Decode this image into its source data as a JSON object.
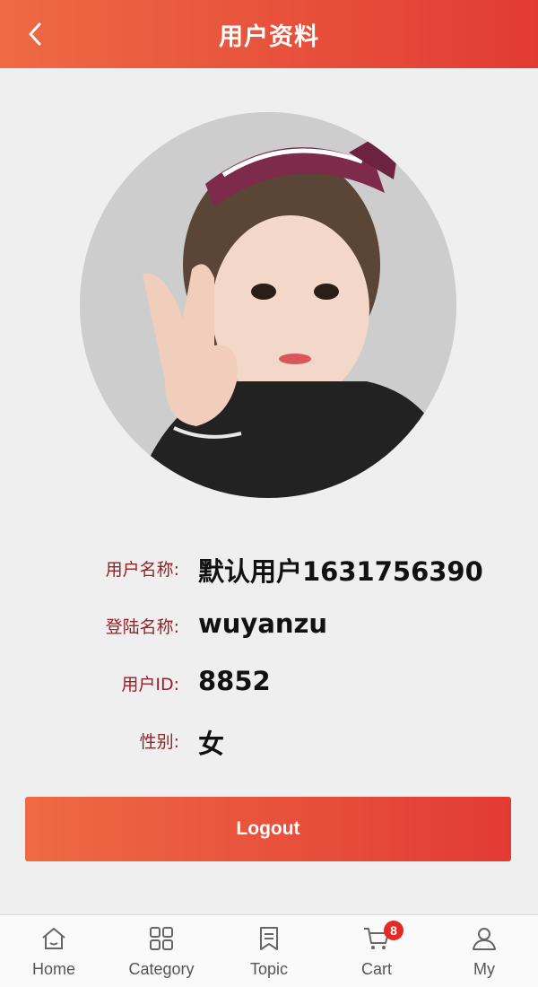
{
  "header": {
    "title": "用户资料",
    "back_icon": "chevron-left-icon"
  },
  "profile": {
    "avatar_icon": "user-photo-avatar",
    "rows": [
      {
        "label": "用户名称:",
        "value": "默认用户1631756390"
      },
      {
        "label": "登陆名称:",
        "value": "wuyanzu"
      },
      {
        "label": "用户ID:",
        "value": "8852"
      },
      {
        "label": "性别:",
        "value": "女"
      }
    ]
  },
  "logout": {
    "label": "Logout"
  },
  "tabbar": {
    "items": [
      {
        "label": "Home",
        "icon": "home-icon"
      },
      {
        "label": "Category",
        "icon": "category-grid-icon"
      },
      {
        "label": "Topic",
        "icon": "topic-bookmark-icon"
      },
      {
        "label": "Cart",
        "icon": "cart-icon",
        "badge": "8"
      },
      {
        "label": "My",
        "icon": "user-icon"
      }
    ]
  },
  "colors": {
    "brand_start": "#ee6a44",
    "brand_end": "#e23b34",
    "label": "#9a1f26",
    "badge": "#e32a27"
  }
}
